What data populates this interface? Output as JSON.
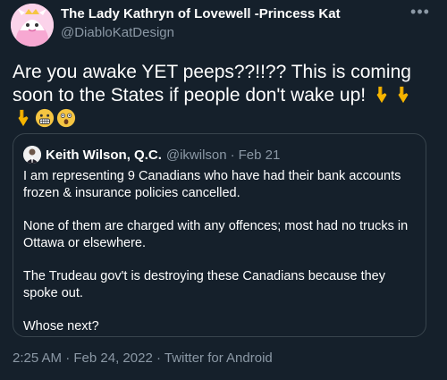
{
  "author": {
    "display_name": "The Lady Kathryn of Lovewell -Princess Kat",
    "handle": "@DiabloKatDesign"
  },
  "tweet": {
    "text": "Are you awake YET peeps??!!?? This is coming soon to the States if people don't wake up!",
    "emojis": [
      "pointing-down-icon",
      "pointing-down-icon",
      "pointing-down-icon",
      "grimacing-face-icon",
      "astonished-face-icon"
    ]
  },
  "more_label": "•••",
  "quote": {
    "name": "Keith Wilson, Q.C.",
    "handle": "@ikwilson",
    "separator": "·",
    "date": "Feb 21",
    "paragraphs": [
      "I am representing 9 Canadians who have had their bank accounts frozen & insurance policies cancelled.",
      "None of them are charged with any offences; most had no trucks in Ottawa or elsewhere.",
      "The Trudeau gov't is destroying these Canadians because they spoke out.",
      "Whose next?"
    ]
  },
  "footer": {
    "time": "2:25 AM",
    "separator": " · ",
    "date": "Feb 24, 2022",
    "source": "Twitter for Android"
  },
  "colors": {
    "background": "#15202b",
    "secondary_text": "#8b98a5",
    "border": "#38444d",
    "text": "#ffffff"
  }
}
